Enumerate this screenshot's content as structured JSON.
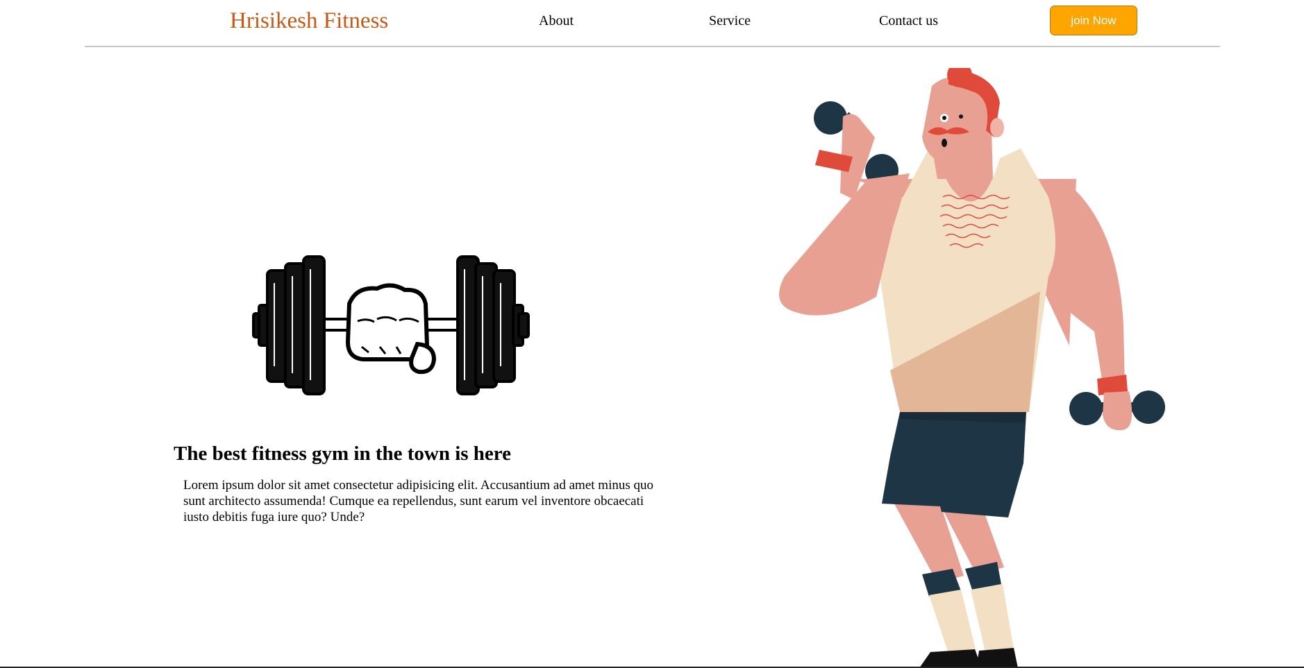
{
  "header": {
    "brand": "Hrisikesh Fitness",
    "nav": {
      "about": "About",
      "service": "Service",
      "contact": "Contact us"
    },
    "cta_label": "join Now"
  },
  "hero": {
    "headline": "The best fitness gym in the town is here",
    "body": "Lorem ipsum dolor sit amet consectetur adipisicing elit. Accusantium ad amet minus quo sunt architecto assumenda! Cumque ea repellendus, sunt earum vel inventore obcaecati iusto debitis fuga iure quo? Unde?"
  },
  "icons": {
    "logo": "dumbbell-fist-icon",
    "illustration": "man-lifting-dumbbells-illustration"
  },
  "colors": {
    "brand": "#c55a17",
    "cta_background": "#ffa500",
    "cta_text": "#ffffff",
    "skin": "#e8a092",
    "tank_top": "#f3e0c4",
    "shorts": "#1e3545",
    "accent_red": "#e04a3a"
  }
}
